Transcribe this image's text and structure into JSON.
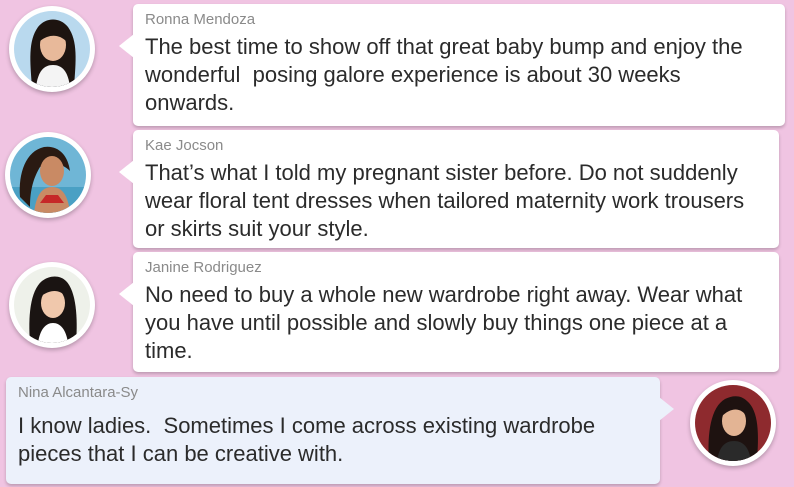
{
  "thread": {
    "messages": [
      {
        "sender": "Ronna Mendoza",
        "text": "The best time to show off that great baby bump and enjoy the wonderful  posing galore experience is about 30 weeks onwards.",
        "avatar": "avatar-ronna-mendoza"
      },
      {
        "sender": "Kae Jocson",
        "text": "That’s what I told my pregnant sister before. Do not suddenly wear floral tent dresses when tailored maternity work trousers or skirts suit your style.",
        "avatar": "avatar-kae-jocson"
      },
      {
        "sender": "Janine Rodriguez",
        "text": "No need to buy a whole new wardrobe right away. Wear what you have until possible and slowly buy things one piece at a time.",
        "avatar": "avatar-janine-rodriguez"
      },
      {
        "sender": "Nina Alcantara-Sy",
        "text": "I know ladies.  Sometimes I come across existing wardrobe pieces that I can be creative with.",
        "avatar": "avatar-nina-alcantara-sy"
      }
    ]
  },
  "colors": {
    "background": "#f0c4e2",
    "bubble": "#ffffff",
    "bubble_self": "#ecf1fb",
    "sender_text": "#8a8a8a",
    "body_text": "#2b2b2b"
  }
}
